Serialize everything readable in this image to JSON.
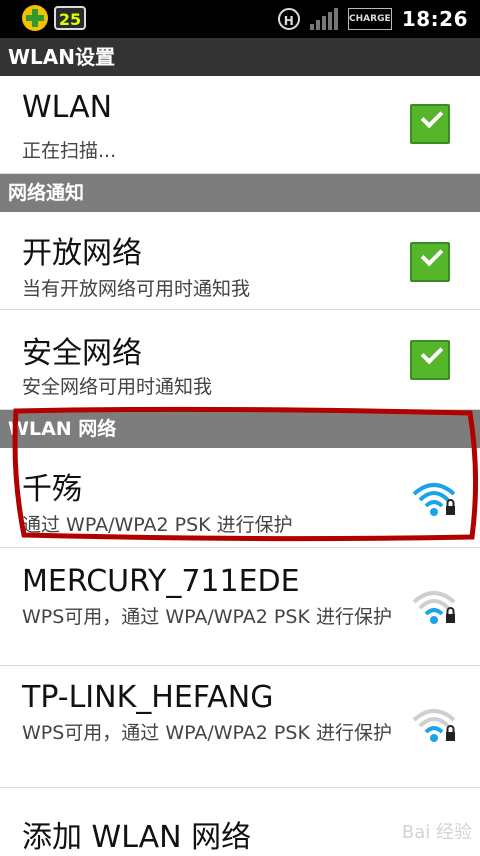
{
  "status_bar": {
    "badge_value": "25",
    "hsp_icon_letter": "H",
    "battery_label": "CHARGE",
    "time": "18:26"
  },
  "header": {
    "title": "WLAN设置"
  },
  "wlan_toggle": {
    "title": "WLAN",
    "status": "正在扫描...",
    "checked": true
  },
  "sections": {
    "notifications": "网络通知",
    "networks": "WLAN 网络"
  },
  "notify_open": {
    "title": "开放网络",
    "subtitle": "当有开放网络可用时通知我",
    "checked": true
  },
  "notify_secure": {
    "title": "安全网络",
    "subtitle": "安全网络可用时通知我",
    "checked": true
  },
  "networks": [
    {
      "ssid": "千殇",
      "security": "通过 WPA/WPA2 PSK 进行保护",
      "signal_level": 3,
      "highlighted": true
    },
    {
      "ssid": "MERCURY_711EDE",
      "security": "WPS可用，通过 WPA/WPA2 PSK 进行保护",
      "signal_level": 1
    },
    {
      "ssid": "TP-LINK_HEFANG",
      "security": "WPS可用，通过 WPA/WPA2 PSK 进行保护",
      "signal_level": 1
    }
  ],
  "add_network": {
    "label": "添加 WLAN 网络"
  },
  "watermark": "Bai 经验",
  "colors": {
    "accent_green": "#55b52b",
    "section_gray": "#7d7d7d",
    "wifi_blue": "#1aa3e8",
    "annotation_red": "#b00000"
  }
}
